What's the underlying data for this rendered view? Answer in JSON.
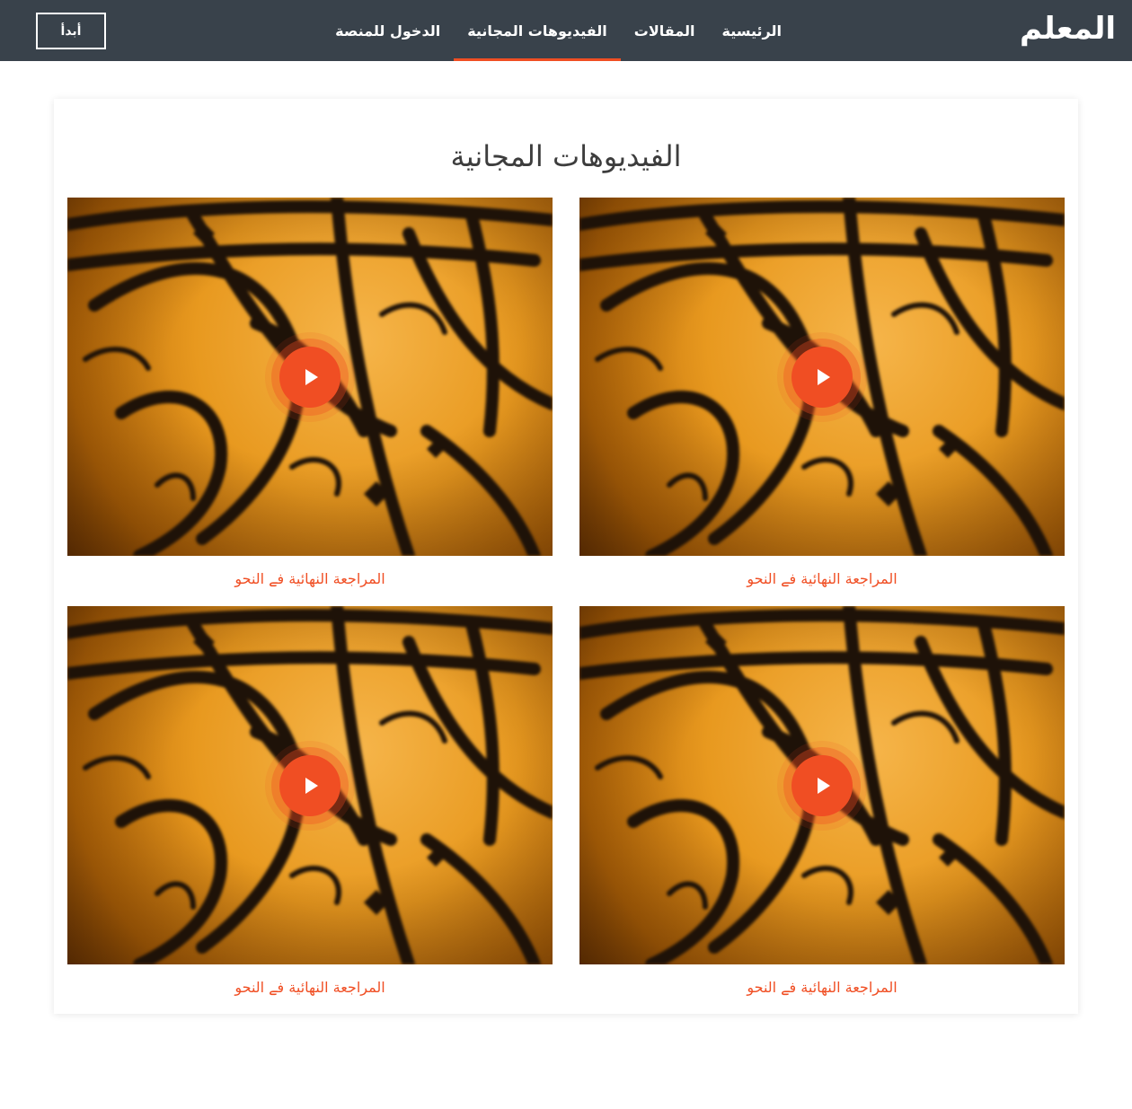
{
  "theme": {
    "nav_background": "#39424b",
    "accent": "#f04e23",
    "title_color": "#3d3d3d"
  },
  "header": {
    "brand": "المعلم",
    "nav": [
      {
        "label": "الرئيسية",
        "active": false
      },
      {
        "label": "المقالات",
        "active": false
      },
      {
        "label": "الفيديوهات المجانية",
        "active": true
      },
      {
        "label": "الدخول للمنصة",
        "active": false
      }
    ],
    "start_button": "أبدأ"
  },
  "main": {
    "title": "الفيديوهات المجانية",
    "videos": [
      {
        "title": "المراجعة النهائية فے النحو",
        "thumbnail_icon": "arabic-calligraphy-thumbnail",
        "play_icon": "play-icon"
      },
      {
        "title": "المراجعة النهائية فے النحو",
        "thumbnail_icon": "arabic-calligraphy-thumbnail",
        "play_icon": "play-icon"
      },
      {
        "title": "المراجعة النهائية فے النحو",
        "thumbnail_icon": "arabic-calligraphy-thumbnail",
        "play_icon": "play-icon"
      },
      {
        "title": "المراجعة النهائية فے النحو",
        "thumbnail_icon": "arabic-calligraphy-thumbnail",
        "play_icon": "play-icon"
      }
    ]
  }
}
